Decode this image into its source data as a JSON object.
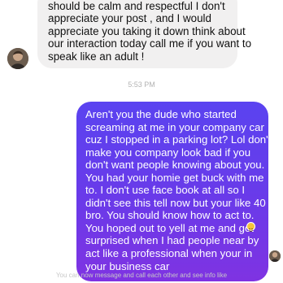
{
  "incoming_message": {
    "lines": [
      "should be calm and respectful I don't",
      "appreciate your post , and I would",
      "appreciate you taking it down think about",
      "our interaction today call me if you want to",
      "speak like an adult !"
    ]
  },
  "timestamp": "5:53 PM",
  "outgoing_message": {
    "lines": [
      "Aren't you the dude who started",
      "screaming at me in your company car",
      "cuz I stopped in a parking lot? Lol don't",
      "make you company look bad if you",
      "don't want people knowing about you.",
      "You had your homie get buck with me",
      "to.   I don't use face book at all so I",
      "didn't see this tell now but your like 40",
      "bro.  You should know how to act to.",
      "You hoped out to yell at me and got",
      "surprised when I had people near by",
      "act like a professional when your in",
      "your business car"
    ]
  },
  "reaction_icon": "smiley-emoji-icon",
  "footer_text": "You can now message and call each other and see info like",
  "colors": {
    "incoming_bubble": "#f1f0f0",
    "outgoing_bubble_top": "#5a43f0",
    "outgoing_bubble_bottom": "#7f33e2"
  }
}
